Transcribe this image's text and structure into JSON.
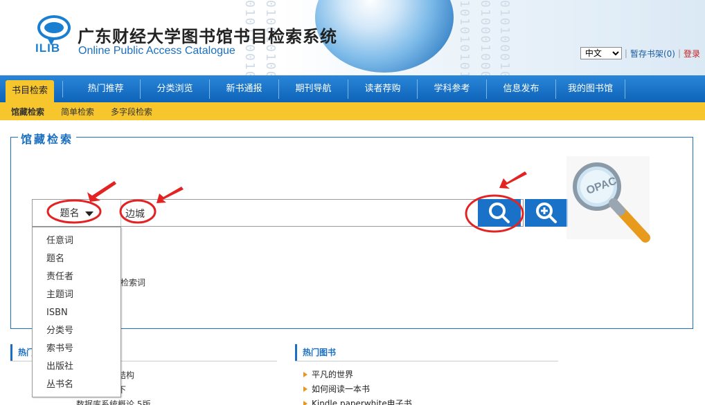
{
  "header": {
    "logo_text": "ILIB",
    "title": "广东财经大学图书馆书目检索系统",
    "subtitle": "Online Public Access Catalogue",
    "language": "中文",
    "shelf_link": "暂存书架(0)",
    "separator": "|",
    "login_link": "登录"
  },
  "main_nav": [
    {
      "label": "书目检索"
    },
    {
      "label": "热门推荐"
    },
    {
      "label": "分类浏览"
    },
    {
      "label": "新书通报"
    },
    {
      "label": "期刊导航"
    },
    {
      "label": "读者荐购"
    },
    {
      "label": "学科参考"
    },
    {
      "label": "信息发布"
    },
    {
      "label": "我的图书馆"
    }
  ],
  "sub_nav": [
    {
      "label": "馆藏检索"
    },
    {
      "label": "简单检索"
    },
    {
      "label": "多字段检索"
    }
  ],
  "search": {
    "legend": "馆藏检索",
    "field_selected": "题名",
    "query": "边城",
    "hint_text": "检索词",
    "options": [
      "任意词",
      "题名",
      "责任者",
      "主题词",
      "ISBN",
      "分类号",
      "索书号",
      "出版社",
      "丛书名"
    ],
    "opac_label": "OPAC"
  },
  "panels": {
    "left_title": "热门",
    "left_items": [
      "结构",
      "下",
      "数据库系统概论 5版"
    ],
    "right_title": "热门图书",
    "right_items": [
      "平凡的世界",
      "如何阅读一本书",
      "Kindle paperwhite电子书"
    ]
  },
  "colors": {
    "nav_blue": "#1a72c8",
    "accent_yellow": "#f7c62c",
    "annotation_red": "#e32222"
  }
}
